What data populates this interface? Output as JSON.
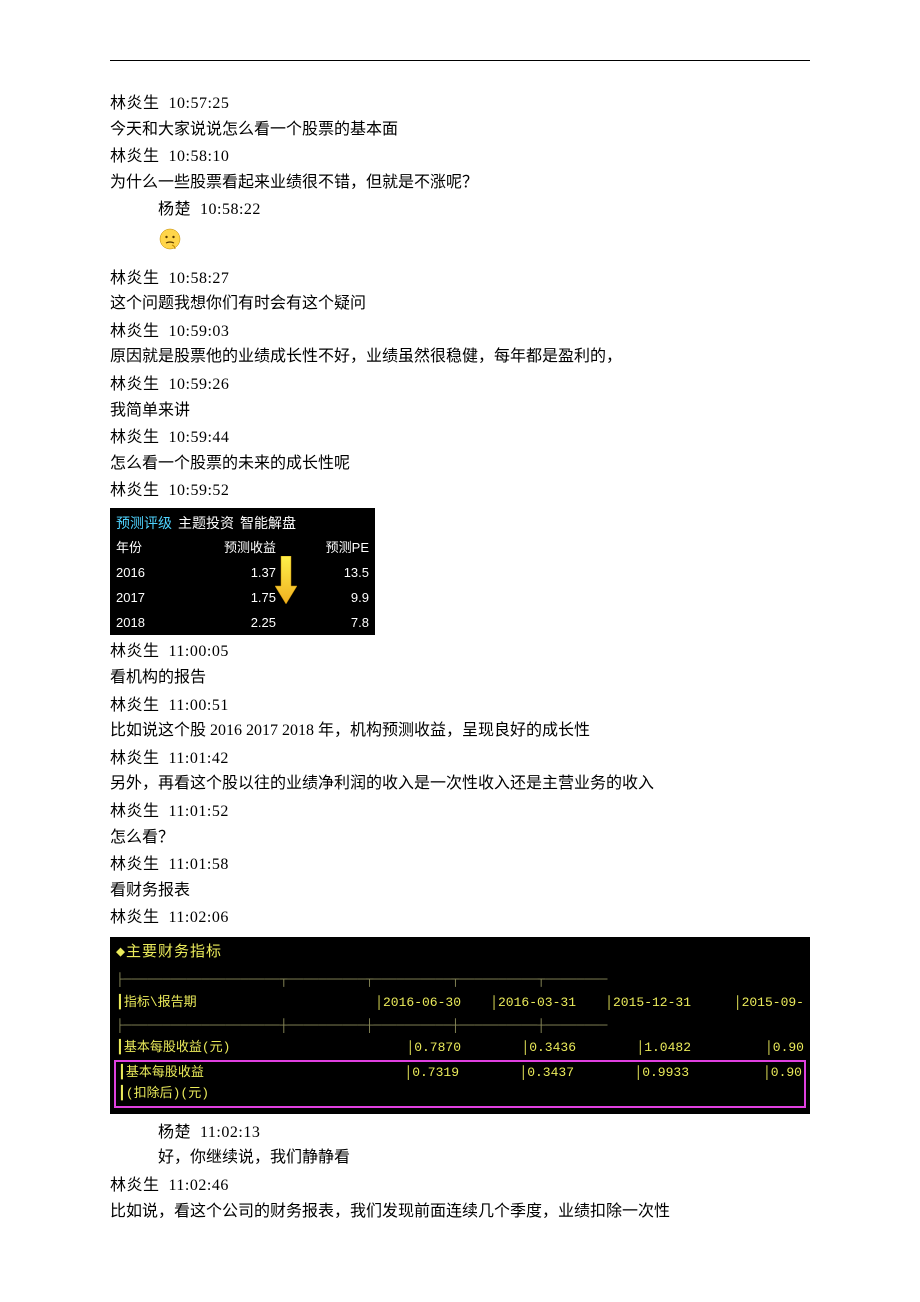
{
  "messages": [
    {
      "name": "林炎生",
      "time": "10:57:25",
      "text": "今天和大家说说怎么看一个股票的基本面",
      "indent": false
    },
    {
      "name": "林炎生",
      "time": "10:58:10",
      "text": "为什么一些股票看起来业绩很不错，但就是不涨呢？",
      "indent": false
    },
    {
      "name": "杨楚",
      "time": "10:58:22",
      "text": "",
      "indent": true,
      "emoji": true
    },
    {
      "name": "林炎生",
      "time": "10:58:27",
      "text": "这个问题我想你们有时会有这个疑问",
      "indent": false
    },
    {
      "name": "林炎生",
      "time": "10:59:03",
      "text": "原因就是股票他的业绩成长性不好，业绩虽然很稳健，每年都是盈利的，",
      "indent": false
    },
    {
      "name": "林炎生",
      "time": "10:59:26",
      "text": "我简单来讲",
      "indent": false
    },
    {
      "name": "林炎生",
      "time": "10:59:44",
      "text": "怎么看一个股票的未来的成长性呢",
      "indent": false
    },
    {
      "name": "林炎生",
      "time": "10:59:52",
      "text": "",
      "indent": false,
      "table1": true
    },
    {
      "name": "林炎生",
      "time": "11:00:05",
      "text": "看机构的报告",
      "indent": false
    },
    {
      "name": "林炎生",
      "time": "11:00:51",
      "text": "比如说这个股 2016  2017  2018 年，机构预测收益，呈现良好的成长性",
      "indent": false
    },
    {
      "name": "林炎生",
      "time": "11:01:42",
      "text": "另外，再看这个股以往的业绩净利润的收入是一次性收入还是主营业务的收入",
      "indent": false
    },
    {
      "name": "林炎生",
      "time": "11:01:52",
      "text": "怎么看？",
      "indent": false
    },
    {
      "name": "林炎生",
      "time": "11:01:58",
      "text": "看财务报表",
      "indent": false
    },
    {
      "name": "林炎生",
      "time": "11:02:06",
      "text": "",
      "indent": false,
      "table2": true
    },
    {
      "name": "杨楚",
      "time": "11:02:13",
      "text": "好，你继续说，我们静静看",
      "indent": true
    },
    {
      "name": "林炎生",
      "time": "11:02:46",
      "text": "比如说，看这个公司的财务报表，我们发现前面连续几个季度，业绩扣除一次性",
      "indent": false
    }
  ],
  "table1": {
    "tabs": [
      "预测评级",
      "主题投资",
      "智能解盘"
    ],
    "headers": [
      "年份",
      "预测收益",
      "预测PE"
    ],
    "rows": [
      {
        "year": "2016",
        "income": "1.37",
        "pe": "13.5"
      },
      {
        "year": "2017",
        "income": "1.75",
        "pe": "9.9"
      },
      {
        "year": "2018",
        "income": "2.25",
        "pe": "7.8"
      }
    ]
  },
  "table2": {
    "title": "◆主要财务指标",
    "header_label": "┃指标\\报告期",
    "periods": [
      "2016-06-30",
      "2016-03-31",
      "2015-12-31",
      "2015-09-"
    ],
    "rows": [
      {
        "label": "┃基本每股收益(元)",
        "v": [
          "0.7870",
          "0.3436",
          "1.0482",
          "0.90"
        ]
      },
      {
        "label": "┃基本每股收益",
        "label2": "┃(扣除后)(元)",
        "v": [
          "0.7319",
          "0.3437",
          "0.9933",
          "0.90"
        ],
        "highlight": true
      }
    ]
  },
  "chart_data": {
    "type": "table",
    "title": "预测评级",
    "categories": [
      "2016",
      "2017",
      "2018"
    ],
    "series": [
      {
        "name": "预测收益",
        "values": [
          1.37,
          1.75,
          2.25
        ]
      },
      {
        "name": "预测PE",
        "values": [
          13.5,
          9.9,
          7.8
        ]
      }
    ]
  }
}
